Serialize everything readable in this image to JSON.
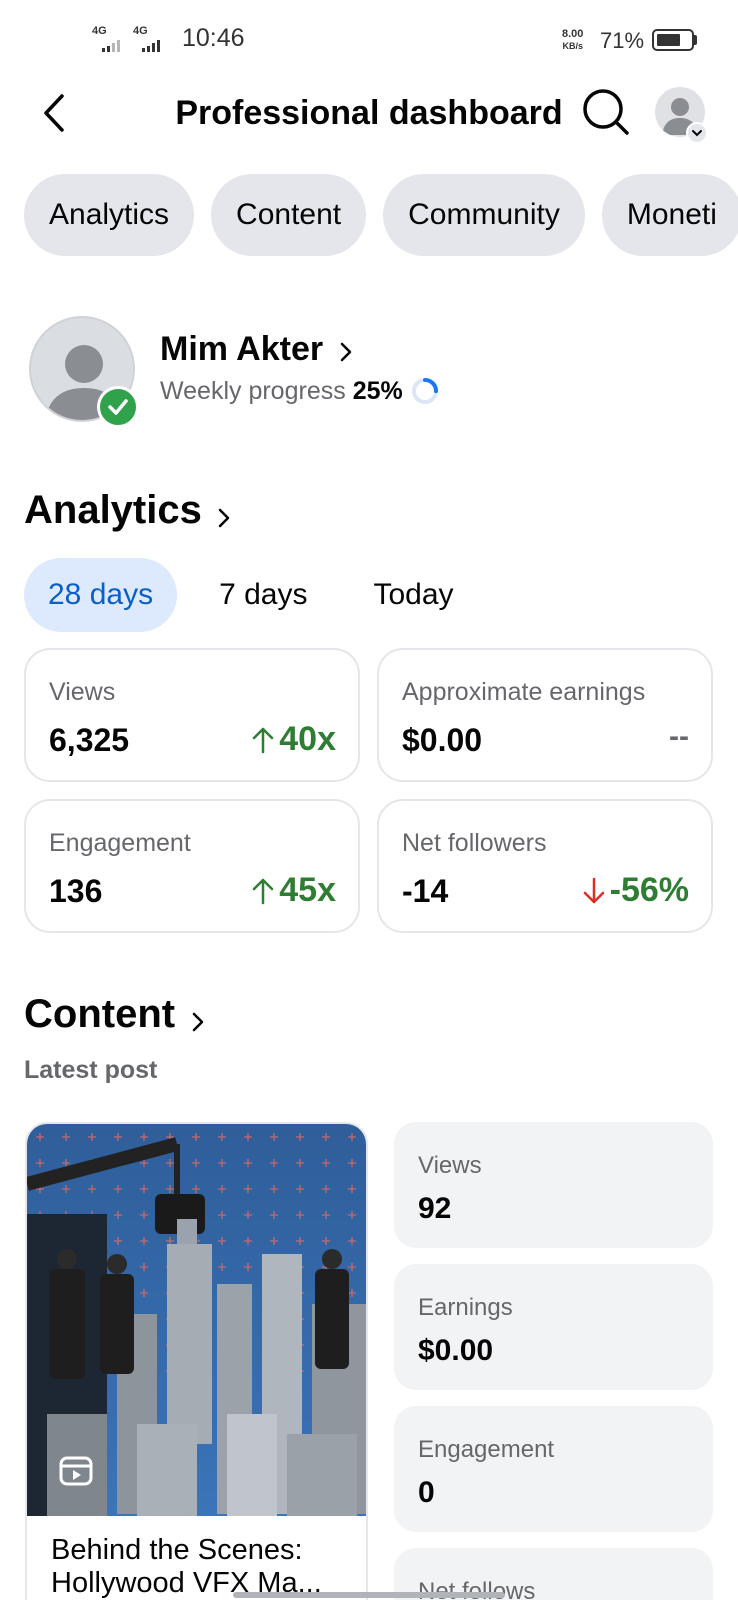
{
  "status_bar": {
    "network1": "4G",
    "network2": "4G",
    "time": "10:46",
    "speed_value": "8.00",
    "speed_unit": "KB/s",
    "battery": "71%",
    "battery_level": 0.71
  },
  "header": {
    "title": "Professional dashboard",
    "back_icon": "back-chevron-icon",
    "search_icon": "search-icon",
    "avatar_icon": "profile-avatar-icon"
  },
  "top_tabs": [
    "Analytics",
    "Content",
    "Community",
    "Moneti"
  ],
  "profile": {
    "name": "Mim Akter",
    "weekly_label": "Weekly progress",
    "weekly_value": "25%",
    "weekly_progress": 0.25,
    "verified_icon": "check-badge-icon"
  },
  "analytics": {
    "title": "Analytics",
    "periods": [
      "28 days",
      "7 days",
      "Today"
    ],
    "active_period": "28 days",
    "accent": "#0a5fc7",
    "cards": [
      {
        "label": "Views",
        "value": "6,325",
        "change": "40x",
        "direction": "up"
      },
      {
        "label": "Approximate earnings",
        "value": "$0.00",
        "change": "--",
        "direction": "none"
      },
      {
        "label": "Engagement",
        "value": "136",
        "change": "45x",
        "direction": "up"
      },
      {
        "label": "Net followers",
        "value": "-14",
        "change": "-56%",
        "direction": "down"
      }
    ],
    "up_color": "#2e7d32",
    "down_arrow_color": "#d93025"
  },
  "content": {
    "title": "Content",
    "subtitle": "Latest post",
    "post_title": "Behind the Scenes: Hollywood VFX Ma...",
    "post_type_icon": "reel-icon",
    "stats": [
      {
        "label": "Views",
        "value": "92"
      },
      {
        "label": "Earnings",
        "value": "$0.00"
      },
      {
        "label": "Engagement",
        "value": "0"
      },
      {
        "label": "Net follows",
        "value": ""
      }
    ]
  }
}
